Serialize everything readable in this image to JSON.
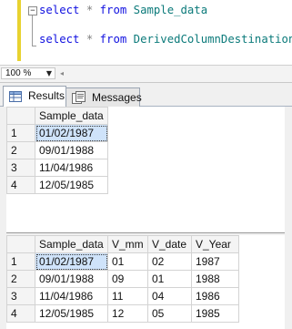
{
  "editor": {
    "collapse_glyph": "−",
    "line1": {
      "kw": "select",
      "star": "*",
      "from": "from",
      "table": "Sample_data"
    },
    "line2": {
      "kw": "select",
      "star": "*",
      "from": "from",
      "table": "DerivedColumnDestination"
    }
  },
  "zoom": {
    "value": "100 %"
  },
  "tabs": [
    {
      "label": "Results",
      "active": true
    },
    {
      "label": "Messages",
      "active": false
    }
  ],
  "grid1": {
    "columns": [
      "Sample_data"
    ],
    "rows": [
      [
        "1",
        "01/02/1987"
      ],
      [
        "2",
        "09/01/1988"
      ],
      [
        "3",
        "11/04/1986"
      ],
      [
        "4",
        "12/05/1985"
      ]
    ]
  },
  "grid2": {
    "columns": [
      "Sample_data",
      "V_mm",
      "V_date",
      "V_Year"
    ],
    "rows": [
      [
        "1",
        "01/02/1987",
        "01",
        "02",
        "1987"
      ],
      [
        "2",
        "09/01/1988",
        "09",
        "01",
        "1988"
      ],
      [
        "3",
        "11/04/1986",
        "11",
        "04",
        "1986"
      ],
      [
        "4",
        "12/05/1985",
        "12",
        "05",
        "1985"
      ]
    ]
  },
  "colors": {
    "keyword": "#1010e0",
    "identifier": "#0b7a7a",
    "selection": "#cfe3fa",
    "change_bar": "#e8d230"
  }
}
